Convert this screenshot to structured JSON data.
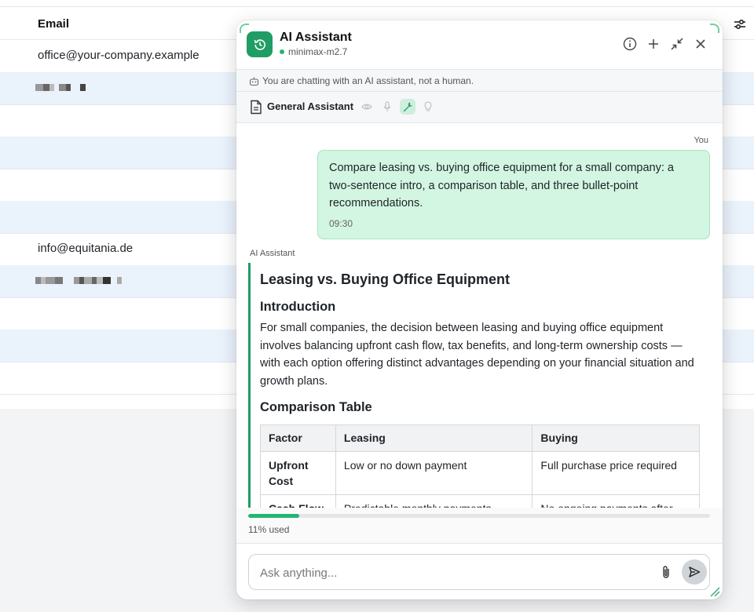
{
  "background_table": {
    "header": {
      "email_col": "Email"
    },
    "rows": [
      {
        "email": "office@your-company.example"
      },
      {
        "email": ""
      },
      {
        "email": ""
      },
      {
        "email": ""
      },
      {
        "email": ""
      },
      {
        "email": ""
      },
      {
        "email": "info@equitania.de"
      },
      {
        "email": ""
      },
      {
        "email": ""
      },
      {
        "email": ""
      },
      {
        "email": ""
      }
    ]
  },
  "panel": {
    "title": "AI Assistant",
    "model": "minimax-m2.7",
    "notice": "You are chatting with an AI assistant, not a human.",
    "mode_label": "General Assistant",
    "header_icons": [
      "info-icon",
      "plus-icon",
      "minimize-icon",
      "close-icon"
    ],
    "mode_tools": [
      "eye-icon",
      "mic-icon",
      "wrench-icon",
      "lightbulb-icon"
    ],
    "active_tool": "wrench-icon",
    "accent": "#1f9d64"
  },
  "user_message": {
    "author": "You",
    "text": "Compare leasing vs. buying office equipment for a small company: a two-sentence intro, a comparison table, and three bullet-point recommendations.",
    "time": "09:30"
  },
  "ai_message": {
    "author": "AI Assistant",
    "heading": "Leasing vs. Buying Office Equipment",
    "intro_heading": "Introduction",
    "intro_text": "For small companies, the decision between leasing and buying office equipment involves balancing upfront cash flow, tax benefits, and long-term ownership costs — with each option offering distinct advantages depending on your financial situation and growth plans.",
    "table_heading": "Comparison Table",
    "table": {
      "headers": [
        "Factor",
        "Leasing",
        "Buying"
      ],
      "rows": [
        [
          "Upfront Cost",
          "Low or no down payment",
          "Full purchase price required"
        ],
        [
          "Cash Flow",
          "Predictable monthly payments",
          "No ongoing payments after"
        ]
      ]
    }
  },
  "usage": {
    "percent": 11,
    "label": "11% used"
  },
  "composer": {
    "placeholder": "Ask anything..."
  }
}
